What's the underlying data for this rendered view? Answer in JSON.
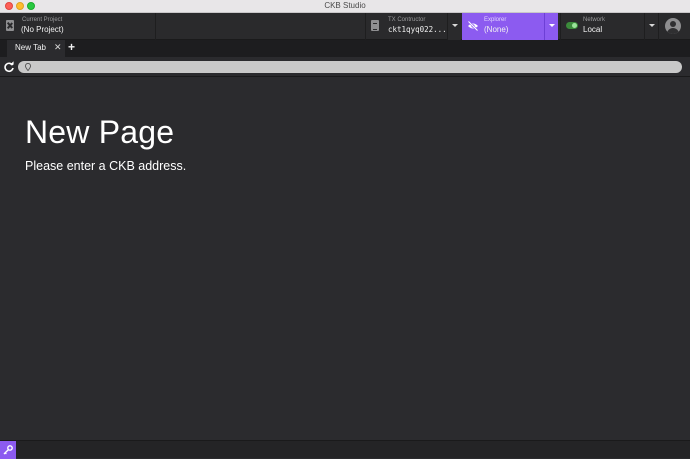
{
  "window": {
    "title": "CKB Studio"
  },
  "header": {
    "project": {
      "label": "Current Project",
      "value": "(No Project)"
    },
    "tx_constructor": {
      "label": "TX Contructor",
      "value": "ckt1qyq022..."
    },
    "explorer": {
      "label": "Explorer",
      "value": "(None)"
    },
    "network": {
      "label": "Network",
      "value": "Local"
    }
  },
  "tabs": [
    {
      "label": "New Tab",
      "close": "✕"
    }
  ],
  "tab_add": "+",
  "address": {
    "value": ""
  },
  "page": {
    "title": "New Page",
    "subtitle": "Please enter a CKB address."
  },
  "colors": {
    "accent": "#8c5bf0",
    "background": "#2b2b2e",
    "network_on": "#3b8a3b"
  }
}
